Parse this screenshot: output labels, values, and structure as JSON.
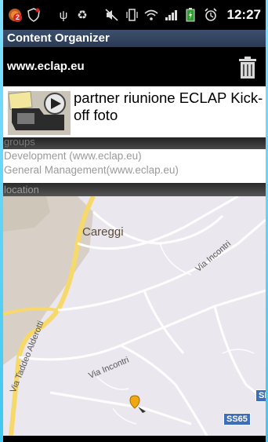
{
  "status_bar": {
    "time": "12:27",
    "notification_badge": "2",
    "icons": [
      "app-notification-icon",
      "shield-icon",
      "usb-icon",
      "recycle-icon",
      "mute-icon",
      "vibrate-icon",
      "wifi-icon",
      "signal-icon",
      "battery-icon",
      "alarm-icon"
    ]
  },
  "app": {
    "title": "Content Organizer"
  },
  "header": {
    "url": "www.eclap.eu"
  },
  "item": {
    "title": "partner riunione ECLAP Kick-off foto"
  },
  "groups": {
    "label": "groups",
    "items": [
      "Development (www.eclap.eu)",
      "General Management(www.eclap.eu)"
    ]
  },
  "location": {
    "label": "location",
    "map_labels": {
      "place": "Careggi",
      "street1": "Via Incontri",
      "street2": "Via Incontri",
      "street3": "Via Taddeo Alderotti",
      "road_badge": "SS65",
      "road_badge_partial": "SR"
    }
  },
  "colors": {
    "title_bar": "#2f405c",
    "map_bg": "#ebe7ee",
    "major_road": "#f6d96a",
    "urban_area": "#d8d0c6"
  }
}
